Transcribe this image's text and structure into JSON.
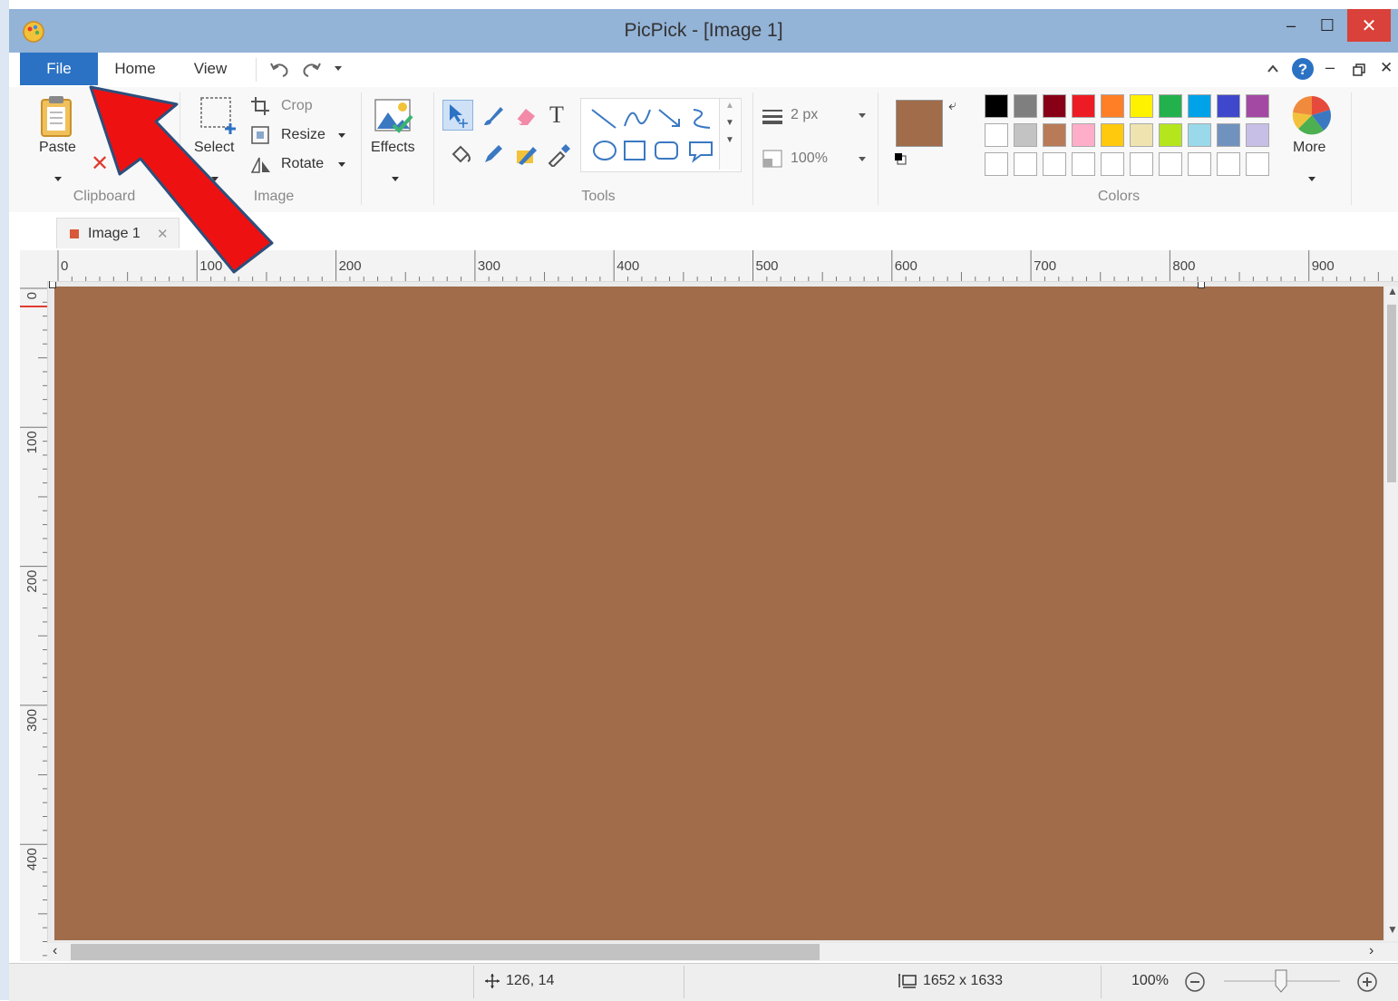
{
  "window": {
    "title": "PicPick - [Image 1]",
    "minimize_glyph": "–",
    "maximize_glyph": "☐",
    "close_glyph": "✕"
  },
  "tabs": [
    {
      "label": "File",
      "active": true
    },
    {
      "label": "Home"
    },
    {
      "label": "View"
    }
  ],
  "quick_access": {
    "undo_icon": "undo-icon",
    "redo_icon": "redo-icon"
  },
  "ribbon": {
    "clipboard": {
      "group_label": "Clipboard",
      "paste_label": "Paste",
      "delete_label": "D"
    },
    "image": {
      "group_label": "Image",
      "select_label": "Select",
      "crop_label": "Crop",
      "resize_label": "Resize",
      "rotate_label": "Rotate"
    },
    "effects": {
      "label": "Effects"
    },
    "tools": {
      "group_label": "Tools"
    },
    "line": {
      "width": "2 px",
      "opacity": "100%"
    },
    "colors": {
      "group_label": "Colors",
      "more_label": "More",
      "foreground": "#a06c4a",
      "background": "#ffffff",
      "palette_row1": [
        "#000000",
        "#7f7f7f",
        "#880015",
        "#ed1c24",
        "#ff7f27",
        "#fff200",
        "#22b14c",
        "#00a2e8",
        "#3f48cc",
        "#a349a4"
      ],
      "palette_row2": [
        "#ffffff",
        "#c3c3c3",
        "#b97a57",
        "#ffaec9",
        "#ffc90e",
        "#efe4b0",
        "#b5e61d",
        "#99d9ea",
        "#7092be",
        "#c8bfe7"
      ],
      "palette_row3": [
        "#ffffff",
        "#ffffff",
        "#ffffff",
        "#ffffff",
        "#ffffff",
        "#ffffff",
        "#ffffff",
        "#ffffff",
        "#ffffff",
        "#ffffff"
      ]
    }
  },
  "document_tab": {
    "label": "Image 1",
    "close_glyph": "✕"
  },
  "ruler": {
    "horizontal_labels": [
      "0",
      "100",
      "200",
      "300",
      "400",
      "500",
      "600",
      "700",
      "800",
      "900"
    ],
    "vertical_labels": [
      "0",
      "100",
      "200",
      "300",
      "400"
    ]
  },
  "canvas": {
    "fill_color": "#a06c4a"
  },
  "annotation": {
    "arrow_color": "#ee1111"
  },
  "status": {
    "cursor_position": "126, 14",
    "image_size": "1652 x 1633",
    "zoom": "100%"
  }
}
